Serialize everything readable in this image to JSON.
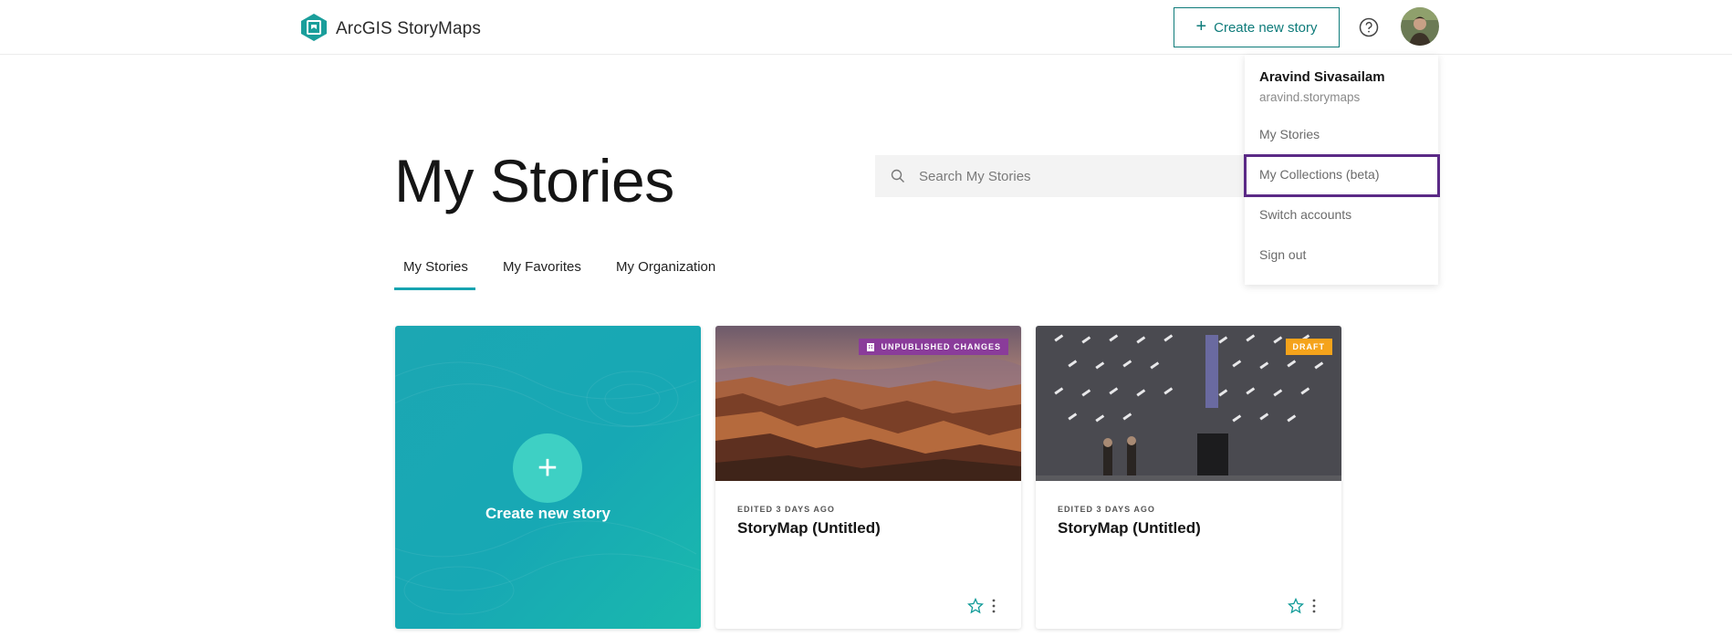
{
  "header": {
    "brand": "ArcGIS StoryMaps",
    "create_button": "Create new story",
    "help_icon": "help-circle-icon",
    "avatar": "user-avatar"
  },
  "page": {
    "title": "My Stories"
  },
  "search": {
    "placeholder": "Search My Stories",
    "value": ""
  },
  "tabs": [
    {
      "label": "My Stories",
      "active": true
    },
    {
      "label": "My Favorites",
      "active": false
    },
    {
      "label": "My Organization",
      "active": false
    }
  ],
  "cards": {
    "create": {
      "label": "Create new story"
    },
    "items": [
      {
        "badge": "UNPUBLISHED CHANGES",
        "meta": "EDITED 3 DAYS AGO",
        "title": "StoryMap (Untitled)"
      },
      {
        "badge": "DRAFT",
        "meta": "EDITED 3 DAYS AGO",
        "title": "StoryMap (Untitled)"
      }
    ]
  },
  "dropdown": {
    "name": "Aravind Sivasailam",
    "username": "aravind.storymaps",
    "items": [
      "My Stories",
      "My Collections (beta)",
      "Switch accounts",
      "Sign out"
    ]
  },
  "colors": {
    "accent": "#0e7b7a",
    "tab_underline": "#16a3b0",
    "unpublished_badge": "#8a3c9a",
    "draft_badge": "#f5a31b",
    "highlight": "#5b2a86"
  }
}
